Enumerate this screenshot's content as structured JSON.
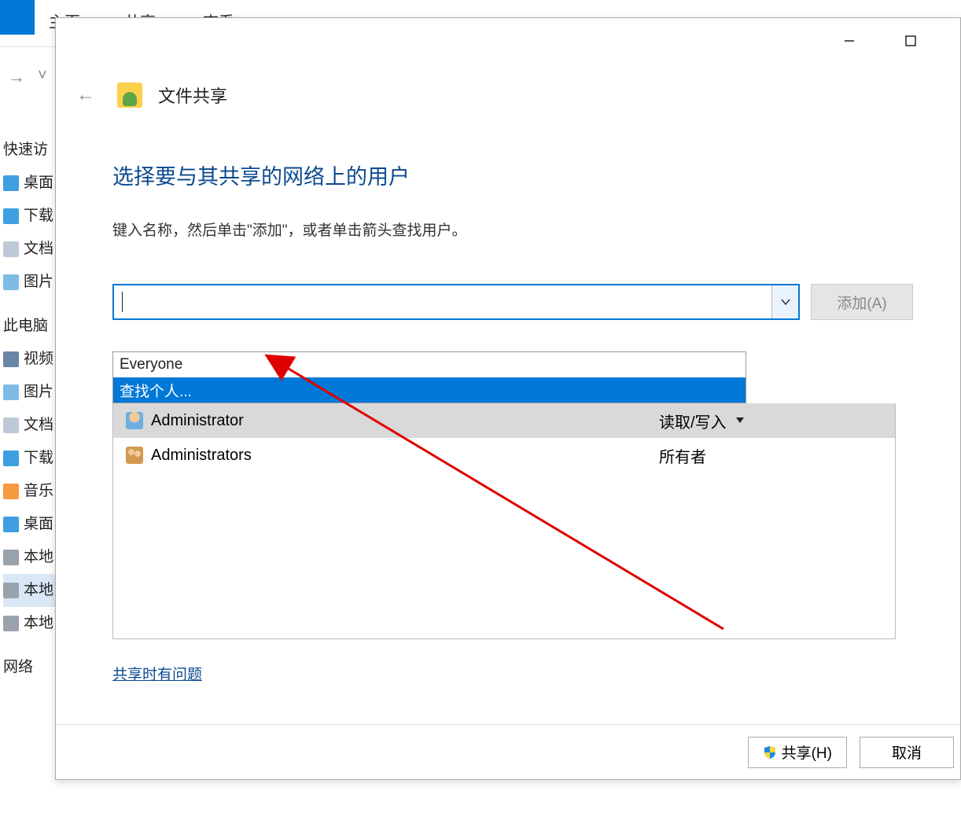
{
  "explorer_bg": {
    "tabs": [
      "主页",
      "共享",
      "查看"
    ],
    "sidebar": {
      "quick_access": "快速访",
      "items": [
        "桌面",
        "下载",
        "文档",
        "图片"
      ],
      "this_pc": "此电脑",
      "pc_items": [
        "视频",
        "图片",
        "文档",
        "下载",
        "音乐",
        "桌面",
        "本地",
        "本地",
        "本地"
      ],
      "network": "网络"
    }
  },
  "modal": {
    "title": "文件共享",
    "heading": "选择要与其共享的网络上的用户",
    "instruction": "键入名称，然后单击\"添加\"，或者单击箭头查找用户。",
    "add_btn": "添加(A)",
    "dropdown": {
      "item0": "Everyone",
      "item1": "查找个人..."
    },
    "users": [
      {
        "name": "Administrator",
        "perm": "读取/写入"
      },
      {
        "name": "Administrators",
        "perm": "所有者"
      }
    ],
    "help_link": "共享时有问题",
    "footer": {
      "share": "共享(H)",
      "cancel": "取消"
    }
  }
}
